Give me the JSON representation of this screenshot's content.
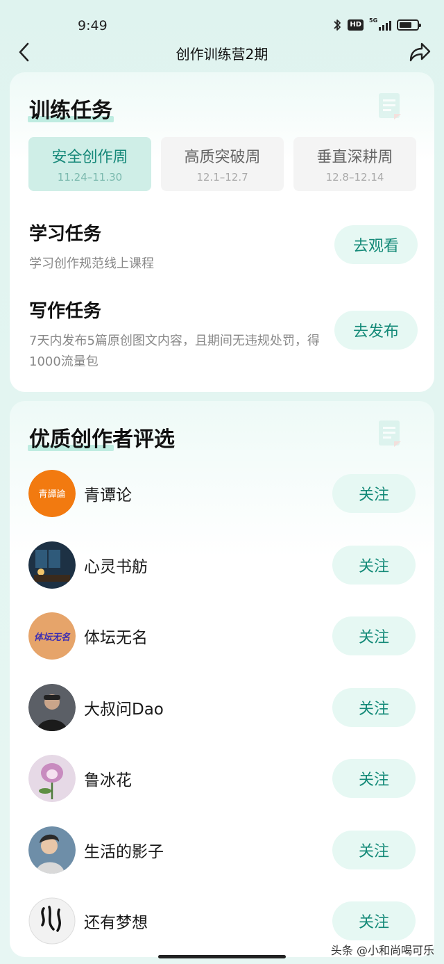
{
  "status_bar": {
    "time": "9:49",
    "network": "5G",
    "hd": "HD"
  },
  "nav": {
    "title": "创作训练营2期",
    "back_icon": "chevron-left-icon",
    "share_icon": "share-icon"
  },
  "training": {
    "title": "训练任务",
    "weeks": [
      {
        "name": "安全创作周",
        "dates": "11.24–11.30",
        "active": true
      },
      {
        "name": "高质突破周",
        "dates": "12.1–12.7",
        "active": false
      },
      {
        "name": "垂直深耕周",
        "dates": "12.8–12.14",
        "active": false
      }
    ],
    "tasks": [
      {
        "title": "学习任务",
        "desc": "学习创作规范线上课程",
        "button": "去观看"
      },
      {
        "title": "写作任务",
        "desc": "7天内发布5篇原创图文内容，且期间无违规处罚，得1000流量包",
        "button": "去发布"
      }
    ]
  },
  "authors": {
    "title": "优质创作者评选",
    "follow_label": "关注",
    "items": [
      {
        "name": "青谭论",
        "avatar_text": "青譚論",
        "avatar_color": "#f27a10"
      },
      {
        "name": "心灵书舫",
        "avatar_color": "#1d3144"
      },
      {
        "name": "体坛无名",
        "avatar_text": "体坛无名",
        "avatar_color": "#e6a46a"
      },
      {
        "name": "大叔问Dao",
        "avatar_color": "#5b5f66"
      },
      {
        "name": "鲁冰花",
        "avatar_color": "#e6d9e6"
      },
      {
        "name": "生活的影子",
        "avatar_color": "#6e8ea8"
      },
      {
        "name": "还有梦想",
        "avatar_color": "#f2f2f2"
      }
    ]
  },
  "watermark": "头条 @小和尚喝可乐",
  "colors": {
    "accent": "#148a78",
    "button_bg": "#e6f8f3",
    "tab_active_bg": "#cfeee7",
    "highlight": "#bfece1"
  }
}
